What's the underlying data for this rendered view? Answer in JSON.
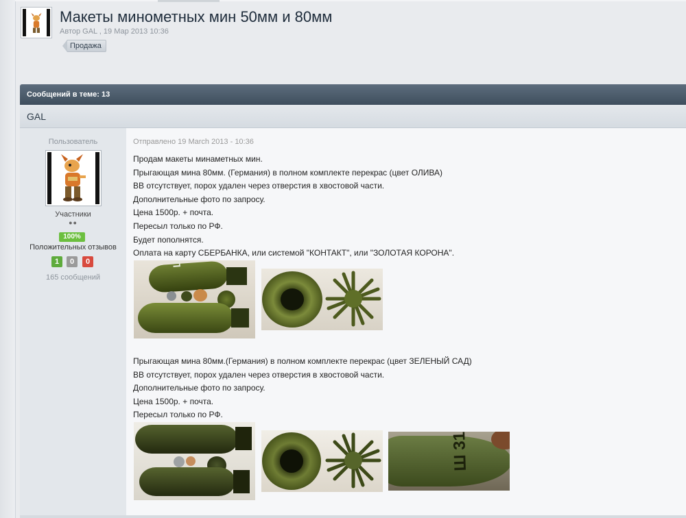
{
  "topic": {
    "title": "Макеты минометных мин 50мм и 80мм",
    "meta": "Автор GAL , 19 Мар 2013 10:36",
    "tag": "Продажа"
  },
  "thread": {
    "bar_label": "Сообщений в теме: 13",
    "author_name": "GAL"
  },
  "sidebar": {
    "role": "Пользователь",
    "group": "Участники",
    "pips": "●●",
    "reputation": "100%",
    "feedback_label": "Положительных отзывов",
    "feedback_positive": "1",
    "feedback_neutral": "0",
    "feedback_negative": "0",
    "post_count": "165 сообщений"
  },
  "post": {
    "date": "Отправлено 19 March 2013 - 10:36",
    "block1": [
      "Продам макеты минаметных мин.",
      "Прыгающая мина 80мм. (Германия) в полном комплекте перекрас (цвет ОЛИВА)",
      "ВВ отсутствует, порох удален через отверстия в хвостовой части.",
      "Дополнительные фото по запросу.",
      "Цена 1500р. + почта.",
      "Пересыл только по РФ.",
      "Будет пополнятся.",
      "Оплата на карту СБЕРБАНКА, или системой \"КОНТАКТ\", или \"ЗОЛОТАЯ КОРОНА\"."
    ],
    "block2": [
      "Прыгающая мина 80мм.(Германия)  в полном комплекте перекрас (цвет ЗЕЛЕНЫЙ САД)",
      "ВВ отсутствует, порох удален через отверстия в хвостовой части.",
      "Дополнительные фото по запросу.",
      "Цена 1500р. + почта.",
      "Пересыл только по РФ."
    ],
    "shell_marking": "Ш 31"
  }
}
